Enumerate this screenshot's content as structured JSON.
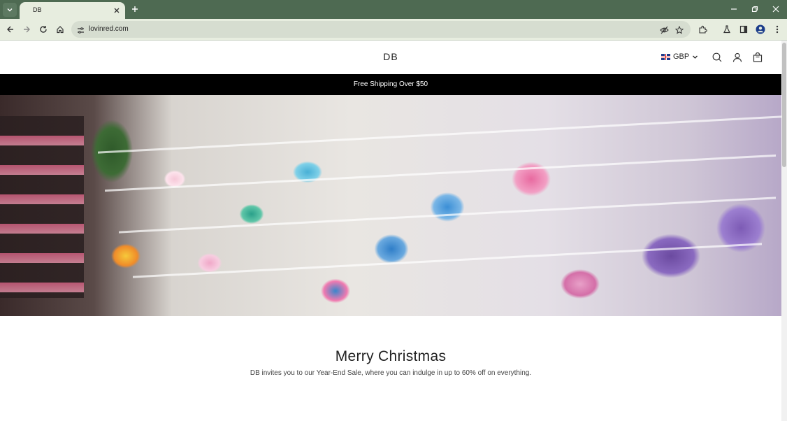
{
  "browser": {
    "tab_title": "DB",
    "url": "lovinred.com"
  },
  "site": {
    "logo": "DB",
    "currency": "GBP",
    "announcement": "Free Shipping Over $50",
    "promo_title": "Merry Christmas",
    "promo_text": "DB invites you to our Year-End Sale, where you can indulge in up to 60% off on everything."
  },
  "colors": {
    "chrome_dark": "#4e6a52",
    "chrome_light": "#e7eddf",
    "announcement_bg": "#000000"
  }
}
